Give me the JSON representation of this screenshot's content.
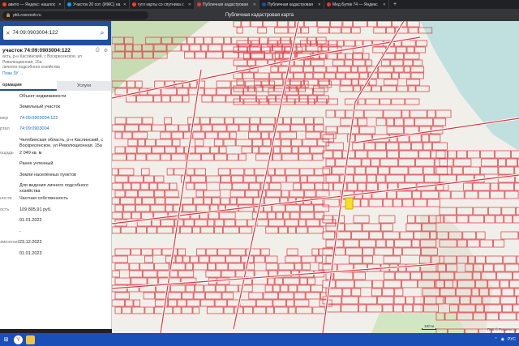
{
  "browser": {
    "tabs": [
      {
        "label": "авито — Яндекс: нашлос",
        "color": "#fc3f1d",
        "active": false
      },
      {
        "label": "Участок 20 сот. (ИЖС) на",
        "color": "#00aaff",
        "active": false
      },
      {
        "label": "гугл карты со спутника с",
        "color": "#fc3f1d",
        "active": false
      },
      {
        "label": "Публичная кадастровая",
        "color": "#e53935",
        "active": true
      },
      {
        "label": "Публичная кадастровая",
        "color": "#1f4f9e",
        "active": false
      },
      {
        "label": "Мед Бутик 74 — Яндекс",
        "color": "#e53935",
        "active": false
      }
    ],
    "url": "pkk.rosreestr.ru",
    "page_title": "Публичная кадастровая карта"
  },
  "panel": {
    "search_value": "74:09:0903004:122",
    "object_title": "участок 74:09:0903004:122",
    "address_lines": [
      "асть, р-н Каслинский, с Воскресенское, ул Революционная, 15а",
      "личного подсобного хозяйства"
    ],
    "plan_link": "План ЗУ →",
    "tabs": {
      "info": "ормация",
      "services": "Услуги"
    },
    "rows": [
      {
        "k": "",
        "v": "Объект недвижимости",
        "link": false
      },
      {
        "k": "",
        "v": "Земельный участок",
        "link": false
      },
      {
        "k": "мер",
        "v": "74:09:0903004:122",
        "link": true
      },
      {
        "k": "ртал",
        "v": "74:09:0903004",
        "link": true
      },
      {
        "k": "",
        "v": "Челябинская область, р-н Каслинский, с Воскресенское, ул Революционная, 15а",
        "link": false
      },
      {
        "k": "ощадь",
        "v": "2 049 кв. м",
        "link": false
      },
      {
        "k": "",
        "v": "Ранее учтенный",
        "link": false
      },
      {
        "k": "",
        "v": "Земли населённых пунктов",
        "link": false
      },
      {
        "k": "",
        "v": "Для ведения личного подсобного хозяйства",
        "link": false
      },
      {
        "k": "ности",
        "v": "Частная собственность",
        "link": false
      },
      {
        "k": "ость",
        "v": "109 805,91 руб.",
        "link": false
      },
      {
        "k": "",
        "v": "01.01.2022",
        "link": false
      },
      {
        "k": "",
        "v": "-",
        "link": false
      },
      {
        "k": "зменений",
        "v": "23.12.2022",
        "link": false
      },
      {
        "k": "",
        "v": "01.01.2023",
        "link": false
      }
    ]
  },
  "map": {
    "scale_label": "100 м",
    "footer": "ПКК © Росреестр",
    "parcel_color": "#e0333c",
    "highlight_color": "#f5e023"
  },
  "taskbar": {
    "lang": "РУС"
  }
}
